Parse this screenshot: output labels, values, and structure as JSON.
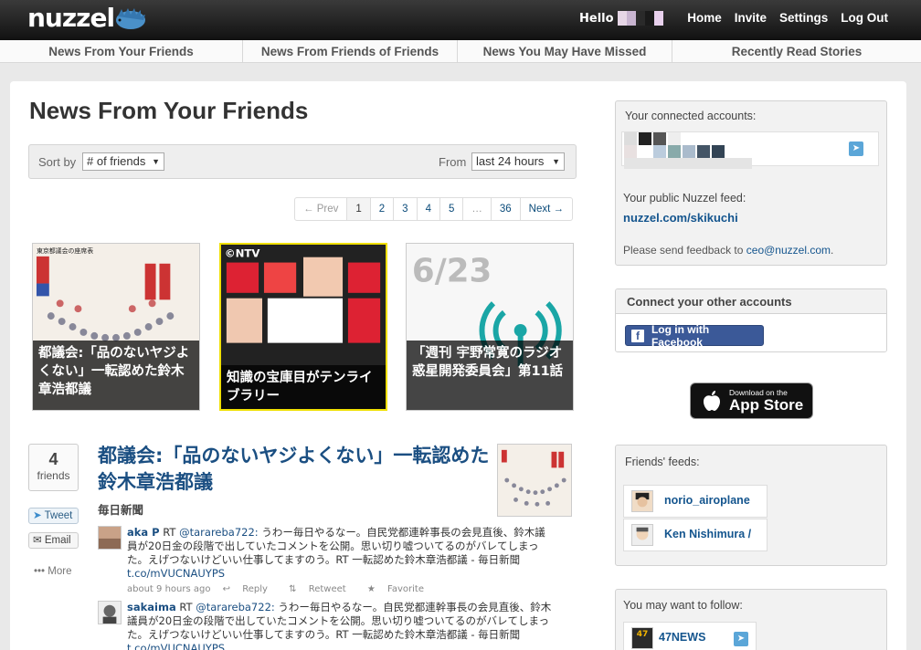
{
  "app": {
    "logo_text": "nuzzel",
    "hello": "Hello",
    "nav": [
      "Home",
      "Invite",
      "Settings",
      "Log Out"
    ]
  },
  "tabs": [
    "News From Your Friends",
    "News From Friends of Friends",
    "News You May Have Missed",
    "Recently Read Stories"
  ],
  "main": {
    "title": "News From Your Friends",
    "sort_label": "Sort by",
    "sort_value": "# of friends",
    "from_label": "From",
    "from_value": "last 24 hours",
    "pager": [
      "← Prev",
      "1",
      "2",
      "3",
      "4",
      "5",
      "…",
      "36",
      "Next →"
    ]
  },
  "featured": [
    {
      "caption": "都議会:「品のないヤジよくない」一転認めた鈴木章浩都議"
    },
    {
      "caption": "知識の宝庫目がテンライブラリー"
    },
    {
      "caption": "「週刊 宇野常寛のラジオ惑星開発委員会」第11話"
    }
  ],
  "featured_image_text": {
    "card1": "東京都議会の座席表",
    "card2": "©NTV",
    "card3": "6/23"
  },
  "story": {
    "count": "4",
    "count_label": "friends",
    "tweet_btn": "Tweet",
    "email_btn": "Email",
    "more": "More",
    "title": "都議会:「品のないヤジよくない」一転認めた鈴木章浩都議",
    "source": "毎日新聞",
    "tweets": [
      {
        "user": "aka P",
        "rt_prefix": "RT",
        "handle": "@tarareba722:",
        "text": "うわー毎日やるなー。自民党都連幹事長の会見直後、鈴木議員が20日金の段階で出していたコメントを公開。思い切り嘘ついてるのがバレてしまった。えげつないけどいい仕事してますのう。RT 一転認めた鈴木章浩都議 - 毎日新聞",
        "link": "t.co/mVUCNAUYPS",
        "time": "about 9 hours ago",
        "reply": "Reply",
        "retweet": "Retweet",
        "favorite": "Favorite"
      },
      {
        "user": "sakaima",
        "rt_prefix": "RT",
        "handle": "@tarareba722:",
        "text": "うわー毎日やるなー。自民党都連幹事長の会見直後、鈴木議員が20日金の段階で出していたコメントを公開。思い切り嘘ついてるのがバレてしまった。えげつないけどいい仕事してますのう。RT 一転認めた鈴木章浩都議 - 毎日新聞",
        "link": "t.co/mVUCNAUYPS"
      }
    ]
  },
  "sidebar": {
    "connected_label": "Your connected accounts:",
    "public_feed_label": "Your public Nuzzel feed:",
    "public_feed_url": "nuzzel.com/skikuchi",
    "feedback_text": "Please send feedback to",
    "feedback_email": "ceo@nuzzel.com",
    "feedback_period": ".",
    "connect_title": "Connect your other accounts",
    "facebook_btn": "Log in with Facebook",
    "appstore_small": "Download on the",
    "appstore_big": "App Store",
    "friends_feeds_label": "Friends' feeds:",
    "friends": [
      {
        "name": "norio_airoplane"
      },
      {
        "name": "Ken Nishimura /"
      }
    ],
    "follow_label": "You may want to follow:",
    "follow": [
      {
        "name": "47NEWS",
        "badge": "47"
      }
    ]
  },
  "colors": {
    "link": "#1b4f82",
    "facebook": "#3b5998",
    "twitter": "#5ba6d8",
    "topbar": "#1a1a1a"
  }
}
